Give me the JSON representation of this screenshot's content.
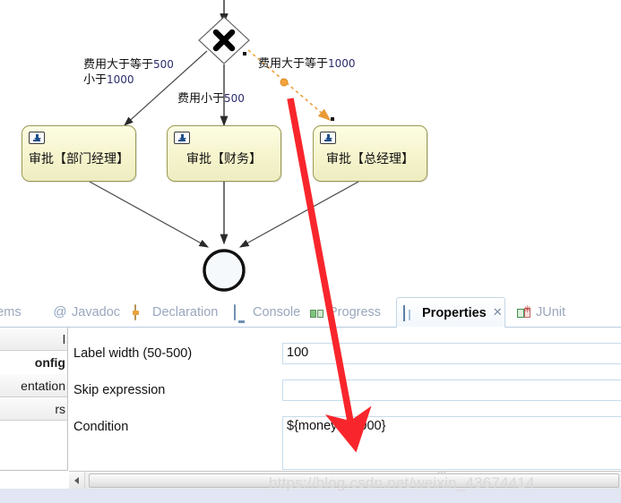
{
  "diagram": {
    "gateway": {
      "name": "exclusive-gateway",
      "symbol": "X"
    },
    "tasks": [
      {
        "id": "dept-manager",
        "label": "审批【部门经理】"
      },
      {
        "id": "finance",
        "label": "审批【财务】"
      },
      {
        "id": "gm",
        "label": "审批【总经理】"
      }
    ],
    "edge_labels": [
      {
        "id": "cond-500-1000-line1",
        "text": "费用大于等于",
        "num": "500"
      },
      {
        "id": "cond-500-1000-line2",
        "text": "小于",
        "num": "1000"
      },
      {
        "id": "cond-lt-500",
        "text": "费用小于",
        "num": "500"
      },
      {
        "id": "cond-gte-1000",
        "text": "费用大于等于",
        "num": "1000"
      }
    ],
    "end_event": {
      "name": "end-event"
    },
    "selected_edge_color": "#f5a33c",
    "annotation_arrow_color": "#f8262c"
  },
  "views": {
    "tabs": [
      {
        "id": "problems",
        "label": "lems",
        "icon": "problems-icon",
        "active": false,
        "closable": false
      },
      {
        "id": "javadoc",
        "label": "Javadoc",
        "icon": "at-icon",
        "active": false,
        "closable": false
      },
      {
        "id": "declaration",
        "label": "Declaration",
        "icon": "declaration-icon",
        "active": false,
        "closable": false
      },
      {
        "id": "console",
        "label": "Console",
        "icon": "console-icon",
        "active": false,
        "closable": false
      },
      {
        "id": "progress",
        "label": "Progress",
        "icon": "progress-icon",
        "active": false,
        "closable": false
      },
      {
        "id": "properties",
        "label": "Properties",
        "icon": "properties-icon",
        "active": true,
        "closable": true,
        "close_glyph": "✕"
      },
      {
        "id": "junit",
        "label": "JUnit",
        "icon": "junit-icon",
        "active": false,
        "closable": false
      }
    ]
  },
  "properties": {
    "sections": [
      {
        "id": "general",
        "label": "l",
        "selected": false
      },
      {
        "id": "main-config",
        "label": "onfig",
        "selected": true
      },
      {
        "id": "documentation",
        "label": "entation",
        "selected": false
      },
      {
        "id": "parameters",
        "label": "rs",
        "selected": false
      }
    ],
    "fields": [
      {
        "id": "label-width",
        "label": "Label width (50-500)",
        "value": "100",
        "placeholder": ""
      },
      {
        "id": "skip-expression",
        "label": "Skip expression",
        "value": "",
        "placeholder": ""
      },
      {
        "id": "condition",
        "label": "Condition",
        "value": "${money>=1000}",
        "placeholder": ""
      }
    ],
    "scrollbar": {
      "left_arrow": "◀"
    }
  },
  "watermark": {
    "text": "https://blog.csdn.net/weixin_43674414",
    "mark": "'''"
  }
}
